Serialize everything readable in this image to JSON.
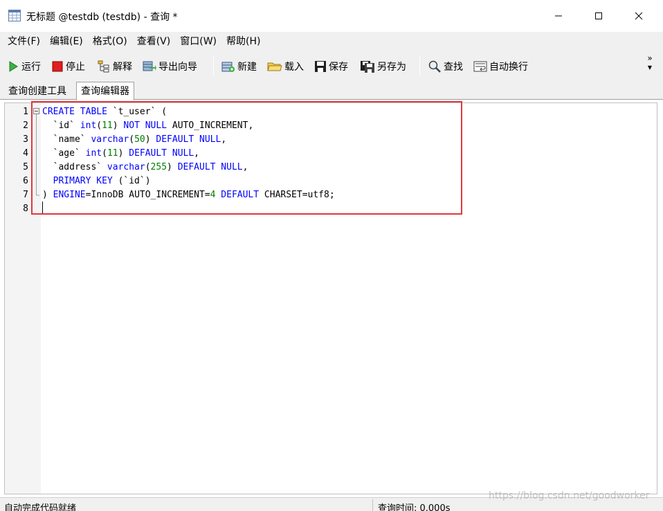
{
  "window": {
    "title": "无标题 @testdb (testdb) - 查询 *",
    "minimize_glyph": "—",
    "maximize_glyph": "☐",
    "close_glyph": "✕"
  },
  "menu": [
    "文件(F)",
    "编辑(E)",
    "格式(O)",
    "查看(V)",
    "窗口(W)",
    "帮助(H)"
  ],
  "toolbar": {
    "run": "运行",
    "stop": "停止",
    "explain": "解释",
    "export_wizard": "导出向导",
    "new": "新建",
    "load": "载入",
    "save": "保存",
    "save_as": "另存为",
    "find": "查找",
    "word_wrap": "自动换行",
    "more_glyph": "»"
  },
  "tabs": {
    "query_builder": "查询创建工具",
    "query_editor": "查询编辑器"
  },
  "editor": {
    "line_numbers": [
      "1",
      "2",
      "3",
      "4",
      "5",
      "6",
      "7",
      "8"
    ],
    "lines": [
      [
        {
          "t": "CREATE TABLE",
          "c": "kw"
        },
        {
          "t": " `t_user` (",
          "c": ""
        }
      ],
      [
        {
          "t": "  `id` ",
          "c": ""
        },
        {
          "t": "int",
          "c": "kw"
        },
        {
          "t": "(",
          "c": ""
        },
        {
          "t": "11",
          "c": "num"
        },
        {
          "t": ") ",
          "c": ""
        },
        {
          "t": "NOT NULL",
          "c": "kw"
        },
        {
          "t": " AUTO_INCREMENT,",
          "c": ""
        }
      ],
      [
        {
          "t": "  `name` ",
          "c": ""
        },
        {
          "t": "varchar",
          "c": "kw"
        },
        {
          "t": "(",
          "c": ""
        },
        {
          "t": "50",
          "c": "num"
        },
        {
          "t": ") ",
          "c": ""
        },
        {
          "t": "DEFAULT NULL",
          "c": "kw"
        },
        {
          "t": ",",
          "c": ""
        }
      ],
      [
        {
          "t": "  `age` ",
          "c": ""
        },
        {
          "t": "int",
          "c": "kw"
        },
        {
          "t": "(",
          "c": ""
        },
        {
          "t": "11",
          "c": "num"
        },
        {
          "t": ") ",
          "c": ""
        },
        {
          "t": "DEFAULT NULL",
          "c": "kw"
        },
        {
          "t": ",",
          "c": ""
        }
      ],
      [
        {
          "t": "  `address` ",
          "c": ""
        },
        {
          "t": "varchar",
          "c": "kw"
        },
        {
          "t": "(",
          "c": ""
        },
        {
          "t": "255",
          "c": "num"
        },
        {
          "t": ") ",
          "c": ""
        },
        {
          "t": "DEFAULT NULL",
          "c": "kw"
        },
        {
          "t": ",",
          "c": ""
        }
      ],
      [
        {
          "t": "  ",
          "c": ""
        },
        {
          "t": "PRIMARY KEY",
          "c": "kw"
        },
        {
          "t": " (`id`)",
          "c": ""
        }
      ],
      [
        {
          "t": ") ",
          "c": ""
        },
        {
          "t": "ENGINE",
          "c": "kw"
        },
        {
          "t": "=InnoDB AUTO_INCREMENT=",
          "c": ""
        },
        {
          "t": "4",
          "c": "num"
        },
        {
          "t": " ",
          "c": ""
        },
        {
          "t": "DEFAULT",
          "c": "kw"
        },
        {
          "t": " CHARSET=utf8;",
          "c": ""
        }
      ],
      []
    ]
  },
  "status": {
    "left": "自动完成代码就绪",
    "right": "查询时间: 0.000s"
  },
  "watermark": "https://blog.csdn.net/goodworker",
  "colors": {
    "keyword": "#0000ff",
    "number": "#008000",
    "highlight_border": "#e0383e"
  }
}
